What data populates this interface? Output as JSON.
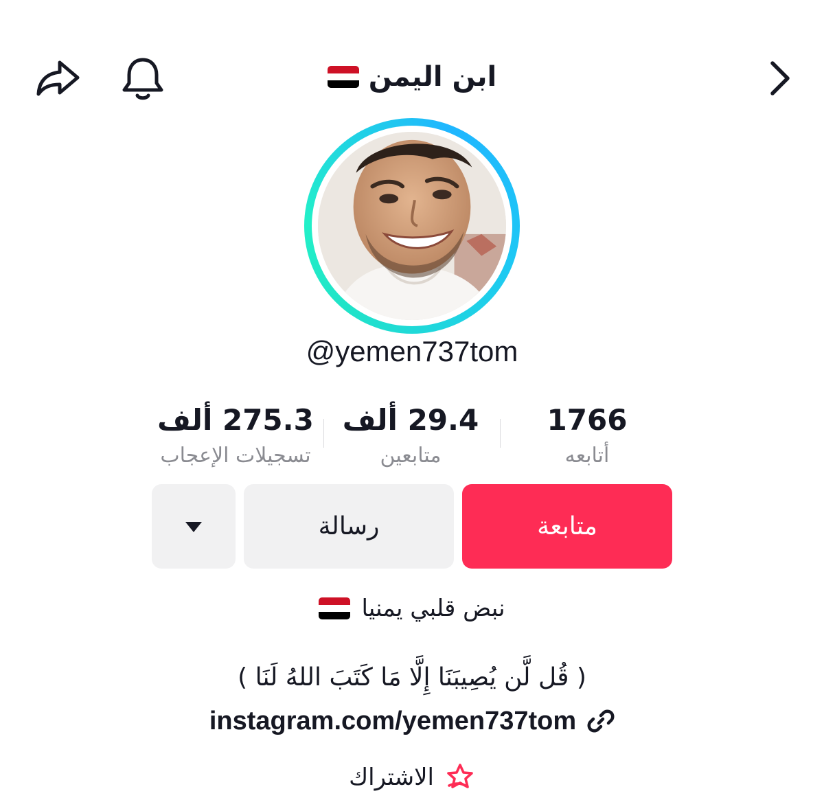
{
  "header": {
    "title": "ابن اليمن",
    "share_icon": "share-icon",
    "bell_icon": "bell-icon",
    "back_icon": "chevron-right-icon"
  },
  "profile": {
    "handle": "@yemen737tom"
  },
  "stats": {
    "following_value": "1766",
    "following_label": "أتابعه",
    "followers_value": "29.4 ألف",
    "followers_label": "متابعين",
    "likes_value": "275.3 ألف",
    "likes_label": "تسجيلات الإعجاب"
  },
  "actions": {
    "follow_label": "متابعة",
    "message_label": "رسالة",
    "more_icon": "caret-down-icon"
  },
  "bio": {
    "line1": "نبض قلبي يمنيا",
    "line2": "( قُل لَّن يُصِيبَنَا إِلَّا مَا كَتَبَ اللهُ لَنَا )",
    "link": "instagram.com/yemen737tom",
    "subscribe_label": "الاشتراك"
  },
  "colors": {
    "accent": "#fe2c55",
    "ring_start": "#1fb6ff",
    "ring_end": "#22f0c8",
    "secondary_button": "#f1f1f2",
    "muted_text": "#8a8b91"
  }
}
